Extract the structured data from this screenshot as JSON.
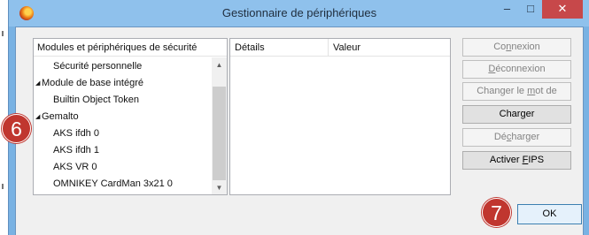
{
  "window": {
    "title": "Gestionnaire de périphériques",
    "controls": {
      "minimize": "–",
      "maximize": "□",
      "close": "✕"
    }
  },
  "tree": {
    "header": "Modules et périphériques de sécurité",
    "rows": [
      {
        "label": "Sécurité personnelle",
        "level": 1
      },
      {
        "label": "Module de base intégré",
        "level": 0,
        "expanded": true
      },
      {
        "label": "Builtin Object Token",
        "level": 1
      },
      {
        "label": "Gemalto",
        "level": 0,
        "expanded": true
      },
      {
        "label": "AKS ifdh 0",
        "level": 1
      },
      {
        "label": "AKS ifdh 1",
        "level": 1
      },
      {
        "label": "AKS VR 0",
        "level": 1
      },
      {
        "label": "OMNIKEY CardMan 3x21 0",
        "level": 1
      }
    ],
    "scroll_up": "▲",
    "scroll_down": "▼"
  },
  "details": {
    "col1": "Détails",
    "col2": "Valeur"
  },
  "buttons": {
    "connexion": {
      "pre": "Co",
      "key": "n",
      "post": "nexion"
    },
    "deconnexion": {
      "pre": "",
      "key": "D",
      "post": "éconnexion"
    },
    "changer_mdp": {
      "pre": "Changer le ",
      "key": "m",
      "post": "ot de passe"
    },
    "charger": {
      "pre": "Char",
      "key": "g",
      "post": "er"
    },
    "decharger": {
      "pre": "Dé",
      "key": "c",
      "post": "harger"
    },
    "activer_fips": {
      "pre": "Activer ",
      "key": "F",
      "post": "IPS"
    },
    "ok": "OK"
  },
  "markers": {
    "six": "6",
    "seven": "7"
  },
  "colors": {
    "marker": "#c0362f",
    "titlebar": "#8fc1ec",
    "close": "#c7484a"
  }
}
